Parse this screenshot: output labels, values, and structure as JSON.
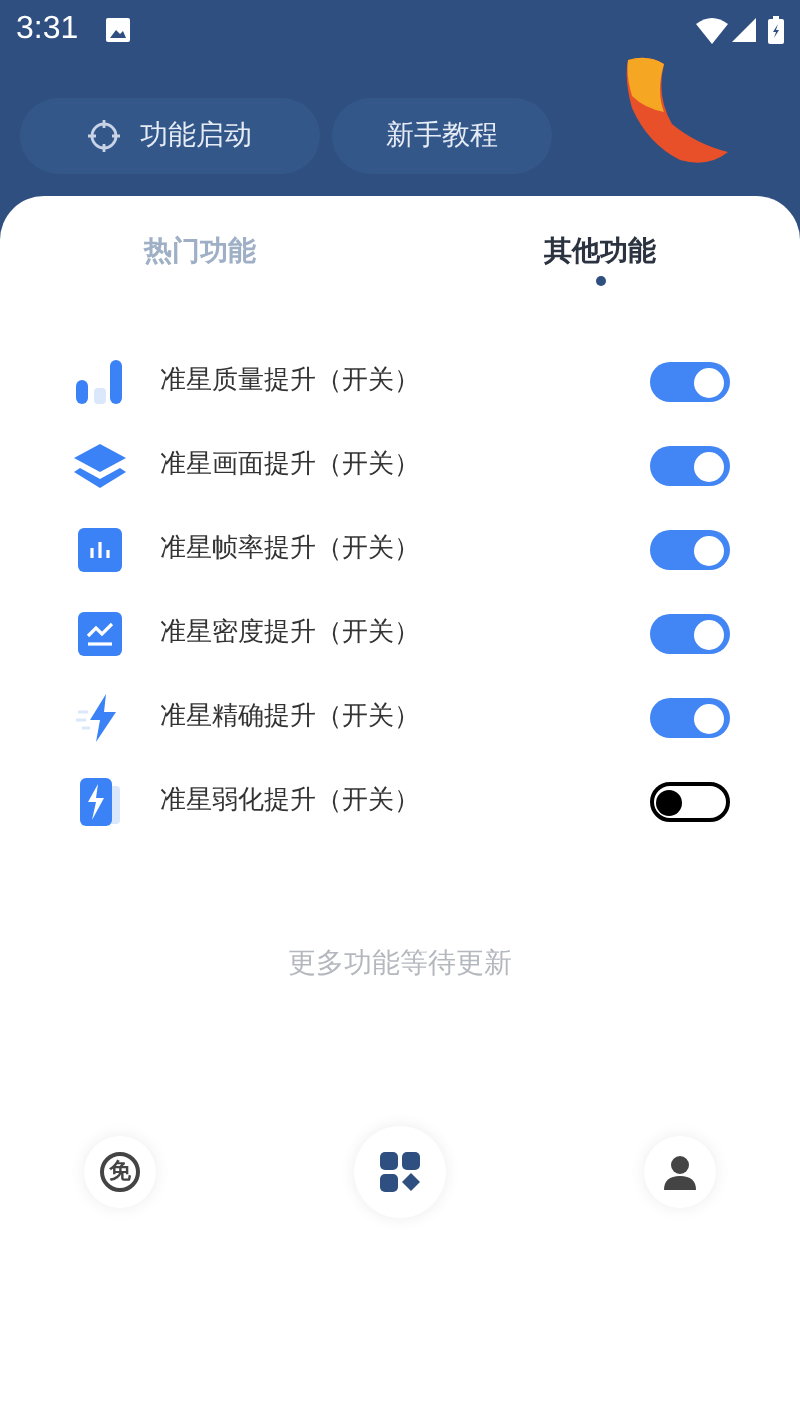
{
  "status_bar": {
    "time": "3:31"
  },
  "header_buttons": [
    {
      "kind": "icon",
      "label": "功能启动"
    },
    {
      "kind": "plain",
      "label": "新手教程"
    }
  ],
  "tabs": [
    {
      "label": "热门功能",
      "selected": false
    },
    {
      "label": "其他功能",
      "selected": true
    }
  ],
  "features": [
    {
      "kind": "bars",
      "label": "准星质量提升（开关）",
      "on": true
    },
    {
      "kind": "layers",
      "label": "准星画面提升（开关）",
      "on": true
    },
    {
      "kind": "chart",
      "label": "准星帧率提升（开关）",
      "on": true
    },
    {
      "kind": "trend",
      "label": "准星密度提升（开关）",
      "on": true
    },
    {
      "kind": "bolt",
      "label": "准星精确提升（开关）",
      "on": true
    },
    {
      "kind": "battery",
      "label": "准星弱化提升（开关）",
      "on": false
    }
  ],
  "footer_note": "更多功能等待更新",
  "bottom_nav": [
    {
      "kind": "free",
      "glyph": "免",
      "selected": false
    },
    {
      "kind": "apps",
      "selected": true
    },
    {
      "kind": "user",
      "selected": false
    }
  ]
}
